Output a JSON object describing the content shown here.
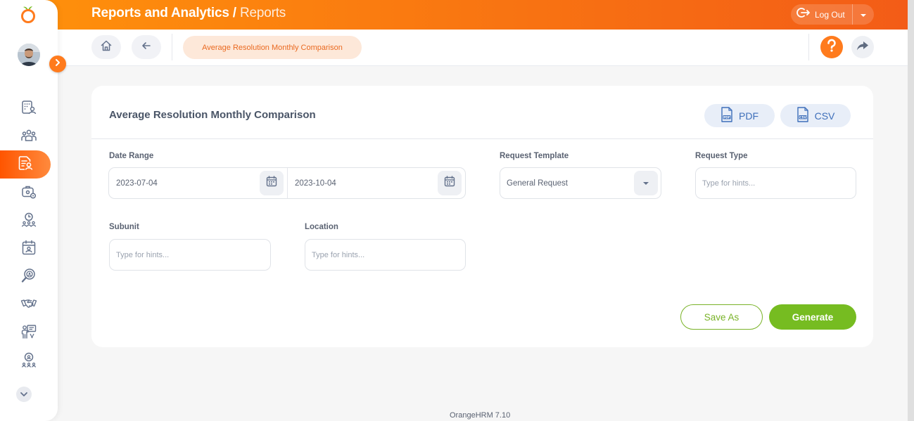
{
  "header": {
    "title": "Reports and Analytics",
    "separator": " / ",
    "subtitle": "Reports",
    "logout_label": "Log Out"
  },
  "breadcrumb": {
    "current": "Average Resolution Monthly Comparison"
  },
  "sidebar": {
    "items": [
      {
        "icon": "directory-icon",
        "active": false
      },
      {
        "icon": "people-icon",
        "active": false
      },
      {
        "icon": "reports-icon",
        "active": true
      },
      {
        "icon": "admin-settings-icon",
        "active": false
      },
      {
        "icon": "time-icon",
        "active": false
      },
      {
        "icon": "calendar-icon",
        "active": false
      },
      {
        "icon": "recruitment-icon",
        "active": false
      },
      {
        "icon": "handshake-icon",
        "active": false
      },
      {
        "icon": "training-icon",
        "active": false
      },
      {
        "icon": "award-icon",
        "active": false
      }
    ]
  },
  "card": {
    "title": "Average Resolution Monthly Comparison",
    "pdf_label": "PDF",
    "csv_label": "CSV",
    "date_range_label": "Date Range",
    "date_from": "2023-07-04",
    "date_to": "2023-10-04",
    "request_template_label": "Request Template",
    "request_template_value": "General Request",
    "request_type_label": "Request Type",
    "request_type_placeholder": "Type for hints...",
    "subunit_label": "Subunit",
    "subunit_placeholder": "Type for hints...",
    "location_label": "Location",
    "location_placeholder": "Type for hints...",
    "save_as_label": "Save As",
    "generate_label": "Generate"
  },
  "footer": {
    "version": "OrangeHRM 7.10"
  },
  "colors": {
    "brand_orange": "#ff7b1d",
    "header_gradient_start": "#ff920b",
    "header_gradient_end": "#f35c17",
    "success_green": "#76bc21",
    "export_blue": "#3e6fba"
  }
}
